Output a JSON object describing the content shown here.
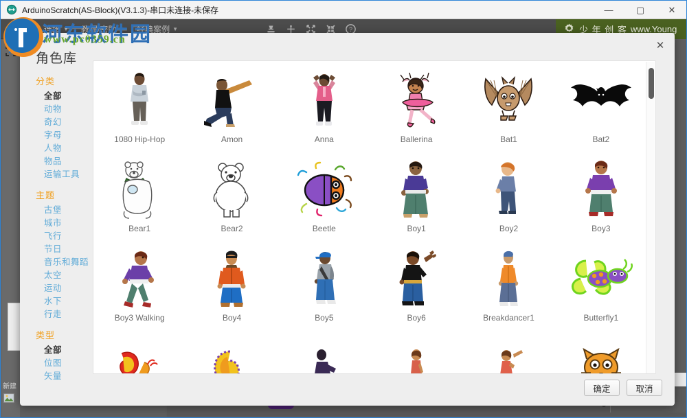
{
  "window": {
    "title": "ArduinoScratch(AS-Block)(V3.1.3)-串口未连接-未保存",
    "app_icon": "arduino-icon",
    "minimize": "—",
    "maximize": "▢",
    "close": "✕"
  },
  "menubar": {
    "items": [
      {
        "label": "文件",
        "has_caret": true
      },
      {
        "label": "连接",
        "has_caret": true
      },
      {
        "label": "教程/密助",
        "has_caret": true
      },
      {
        "label": "经典案例",
        "has_caret": true
      }
    ],
    "tools": [
      {
        "name": "stamp-icon"
      },
      {
        "name": "cut-icon"
      },
      {
        "name": "grow-icon"
      },
      {
        "name": "shrink-icon"
      },
      {
        "name": "help-icon"
      }
    ]
  },
  "promo": {
    "text": "少 年 创 客",
    "url": "www.Young",
    "icon": "gear-icon",
    "color": "#4a6120"
  },
  "background": {
    "new_label": "新建",
    "stage_icon": "image-icon"
  },
  "dialog": {
    "title": "角色库",
    "close_label": "✕",
    "ok_label": "确定",
    "cancel_label": "取消",
    "filters": [
      {
        "heading": "分类",
        "items": [
          {
            "label": "全部",
            "active": true
          },
          {
            "label": "动物",
            "active": false
          },
          {
            "label": "奇幻",
            "active": false
          },
          {
            "label": "字母",
            "active": false
          },
          {
            "label": "人物",
            "active": false
          },
          {
            "label": "物品",
            "active": false
          },
          {
            "label": "运输工具",
            "active": false
          }
        ]
      },
      {
        "heading": "主题",
        "items": [
          {
            "label": "古堡",
            "active": false
          },
          {
            "label": "城市",
            "active": false
          },
          {
            "label": "飞行",
            "active": false
          },
          {
            "label": "节日",
            "active": false
          },
          {
            "label": "音乐和舞蹈",
            "active": false
          },
          {
            "label": "太空",
            "active": false
          },
          {
            "label": "运动",
            "active": false
          },
          {
            "label": "水下",
            "active": false
          },
          {
            "label": "行走",
            "active": false
          }
        ]
      },
      {
        "heading": "类型",
        "items": [
          {
            "label": "全部",
            "active": true
          },
          {
            "label": "位图",
            "active": false
          },
          {
            "label": "矢量",
            "active": false
          }
        ]
      }
    ],
    "sprites": [
      {
        "name": "1080 Hip-Hop",
        "art": "person-standing-gray"
      },
      {
        "name": "Amon",
        "art": "person-lunge-black"
      },
      {
        "name": "Anna",
        "art": "person-arms-up-pink"
      },
      {
        "name": "Ballerina",
        "art": "ballerina-pink"
      },
      {
        "name": "Bat1",
        "art": "bat-brown"
      },
      {
        "name": "Bat2",
        "art": "bat-black"
      },
      {
        "name": "Bear1",
        "art": "bear-scarf-white"
      },
      {
        "name": "Bear2",
        "art": "bear-outline-white"
      },
      {
        "name": "Beetle",
        "art": "beetle-purple"
      },
      {
        "name": "Boy1",
        "art": "boy-purple-shirt"
      },
      {
        "name": "Boy2",
        "art": "boy-blue-shirt"
      },
      {
        "name": "Boy3",
        "art": "boy-purple-hoodie"
      },
      {
        "name": "Boy3 Walking",
        "art": "boy-walking-purple"
      },
      {
        "name": "Boy4",
        "art": "boy-orange-jacket"
      },
      {
        "name": "Boy5",
        "art": "boy-cap-gray"
      },
      {
        "name": "Boy6",
        "art": "boy-black-shirt"
      },
      {
        "name": "Breakdancer1",
        "art": "breakdancer-orange"
      },
      {
        "name": "Butterfly1",
        "art": "butterfly-green-purple"
      },
      {
        "name": "",
        "art": "snail-red-yellow"
      },
      {
        "name": "",
        "art": "shell-purple-yellow"
      },
      {
        "name": "",
        "art": "dancer-purple"
      },
      {
        "name": "",
        "art": "girl-standing"
      },
      {
        "name": "",
        "art": "girl-pointing"
      },
      {
        "name": "",
        "art": "cat-orange"
      }
    ],
    "scroll": {
      "thumb_top_pct": 1,
      "thumb_height_pct": 10
    }
  },
  "watermarks": {
    "site_cn": "河东软件园",
    "site_url": "www.pc0359.cn"
  }
}
